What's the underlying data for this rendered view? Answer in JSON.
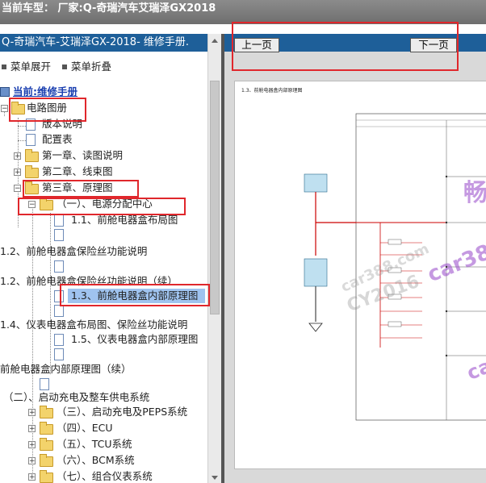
{
  "window": {
    "title": "当前车型： 厂家:Q-奇瑞汽车艾瑞泽GX2018"
  },
  "left_panel": {
    "header": "Q-奇瑞汽车-艾瑞泽GX-2018- 维修手册.",
    "menu_expand": "菜单展开",
    "menu_collapse": "菜单折叠",
    "tree": [
      {
        "label": "当前:维修手册"
      },
      {
        "label": "电路图册"
      },
      {
        "label": "版本说明"
      },
      {
        "label": "配置表"
      },
      {
        "label": "第一章、读图说明"
      },
      {
        "label": "第二章、线束图"
      },
      {
        "label": "第三章、原理图"
      },
      {
        "label": "（一）、电源分配中心"
      },
      {
        "label": "1.1、前舱电器盒布局图"
      },
      {
        "label": "1.2、前舱电器盒保险丝功能说明"
      },
      {
        "label": "1.2、前舱电器盒保险丝功能说明（续）"
      },
      {
        "label": "1.3、前舱电器盒内部原理图"
      },
      {
        "label": "1.4、仪表电器盒布局图、保险丝功能说明"
      },
      {
        "label": "1.5、仪表电器盒内部原理图"
      },
      {
        "label": "前舱电器盒内部原理图（续）"
      },
      {
        "label": "（二）、启动充电及整车供电系统"
      },
      {
        "label": "（三）、启动充电及PEPS系统"
      },
      {
        "label": "（四）、ECU"
      },
      {
        "label": "（五）、TCU系统"
      },
      {
        "label": "（六）、BCM系统"
      },
      {
        "label": "（七）、组合仪表系统"
      }
    ]
  },
  "right_panel": {
    "prev_button": "上一页",
    "next_button": "下一页",
    "doc_title": "1.3、前舱电器盒内部原理图"
  },
  "watermarks": {
    "w1": "畅",
    "w2": "CY2016",
    "w3": "car388.com",
    "w4": "car38",
    "w5": "car"
  },
  "colors": {
    "header_blue": "#1e5f99",
    "highlight_red": "#e0272c",
    "selection_blue": "#9fc3ef",
    "title_bar_gray": "#7a7a7a"
  }
}
